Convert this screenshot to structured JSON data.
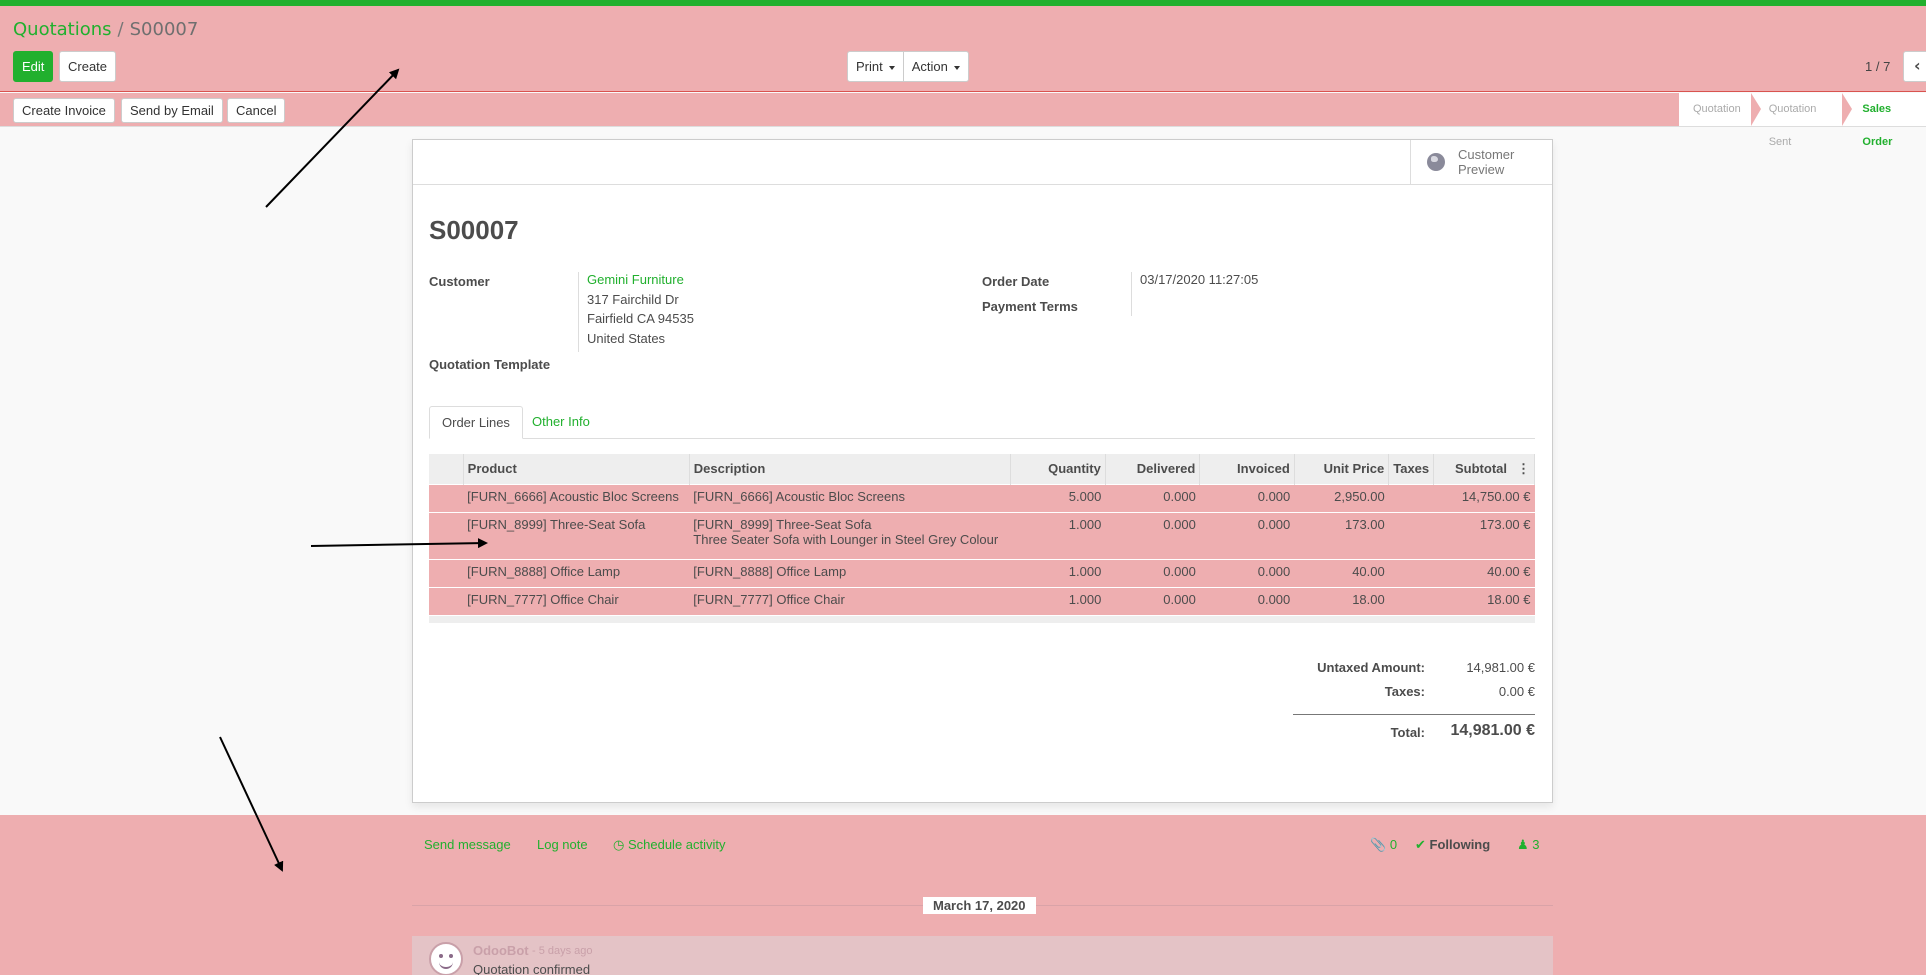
{
  "breadcrumb": {
    "parent": "Quotations",
    "separator": "/",
    "current": "S00007"
  },
  "toolbar": {
    "edit_label": "Edit",
    "create_label": "Create",
    "print_label": "Print",
    "action_label": "Action"
  },
  "pager": {
    "text": "1 / 7"
  },
  "statusbar": {
    "buttons": [
      "Create Invoice",
      "Send by Email",
      "Cancel"
    ],
    "stages": [
      "Quotation",
      "Quotation Sent",
      "Sales Order"
    ],
    "active_stage": "Sales Order"
  },
  "sheet": {
    "preview_label_1": "Customer",
    "preview_label_2": "Preview",
    "name": "S00007",
    "customer_label": "Customer",
    "customer_name": "Gemini Furniture",
    "address_line1": "317 Fairchild Dr",
    "address_line2": "Fairfield CA 94535",
    "address_line3": "United States",
    "template_label": "Quotation Template",
    "order_date_label": "Order Date",
    "order_date": "03/17/2020 11:27:05",
    "payment_terms_label": "Payment Terms"
  },
  "tabs": [
    "Order Lines",
    "Other Info"
  ],
  "table": {
    "headers": [
      "Product",
      "Description",
      "Quantity",
      "Delivered",
      "Invoiced",
      "Unit Price",
      "Taxes",
      "Subtotal"
    ],
    "rows": [
      {
        "product": "[FURN_6666] Acoustic Bloc Screens",
        "desc1": "[FURN_6666] Acoustic Bloc Screens",
        "desc2": "",
        "qty": "5.000",
        "delivered": "0.000",
        "invoiced": "0.000",
        "price": "2,950.00",
        "taxes": "",
        "subtotal": "14,750.00 €"
      },
      {
        "product": "[FURN_8999] Three-Seat Sofa",
        "desc1": "[FURN_8999] Three-Seat Sofa",
        "desc2": "Three Seater Sofa with Lounger in Steel Grey Colour",
        "qty": "1.000",
        "delivered": "0.000",
        "invoiced": "0.000",
        "price": "173.00",
        "taxes": "",
        "subtotal": "173.00 €"
      },
      {
        "product": "[FURN_8888] Office Lamp",
        "desc1": "[FURN_8888] Office Lamp",
        "desc2": "",
        "qty": "1.000",
        "delivered": "0.000",
        "invoiced": "0.000",
        "price": "40.00",
        "taxes": "",
        "subtotal": "40.00 €"
      },
      {
        "product": "[FURN_7777] Office Chair",
        "desc1": "[FURN_7777] Office Chair",
        "desc2": "",
        "qty": "1.000",
        "delivered": "0.000",
        "invoiced": "0.000",
        "price": "18.00",
        "taxes": "",
        "subtotal": "18.00 €"
      }
    ]
  },
  "totals": {
    "untaxed_label": "Untaxed Amount:",
    "untaxed": "14,981.00 €",
    "taxes_label": "Taxes:",
    "taxes": "0.00 €",
    "total_label": "Total:",
    "total": "14,981.00 €"
  },
  "chatter": {
    "send_message": "Send message",
    "log_note": "Log note",
    "schedule_activity": "Schedule activity",
    "attachments_count": "0",
    "following": "Following",
    "followers_count": "3",
    "date": "March 17, 2020",
    "author": "OdooBot",
    "time": "- 5 days ago",
    "body": "Quotation confirmed"
  },
  "colors": {
    "brand": "#21b02e",
    "highlight": "#eeaeb0"
  }
}
